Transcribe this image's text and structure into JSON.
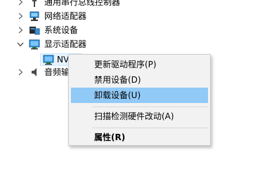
{
  "tree": {
    "items": [
      {
        "label": "通用串行总线控制器",
        "icon": "usb-plug-icon",
        "expanded": false
      },
      {
        "label": "网络适配器",
        "icon": "network-adapter-icon",
        "expanded": false
      },
      {
        "label": "系统设备",
        "icon": "system-device-icon",
        "expanded": false
      },
      {
        "label": "显示适配器",
        "icon": "display-adapter-icon",
        "expanded": true
      },
      {
        "label": "音频输",
        "icon": "speaker-icon",
        "expanded": false
      }
    ],
    "child": {
      "label": "NV",
      "icon": "display-adapter-icon",
      "selected": true
    }
  },
  "context_menu": {
    "items": [
      {
        "label": "更新驱动程序(P)"
      },
      {
        "label": "禁用设备(D)"
      },
      {
        "label": "卸载设备(U)",
        "highlighted": true
      },
      {
        "label": "扫描检测硬件改动(A)"
      },
      {
        "label": "属性(R)",
        "bold": true
      }
    ]
  },
  "colors": {
    "menu_background": "#f2f2f2",
    "menu_highlight": "#91c9f7",
    "selection": "#e5f3ff"
  }
}
